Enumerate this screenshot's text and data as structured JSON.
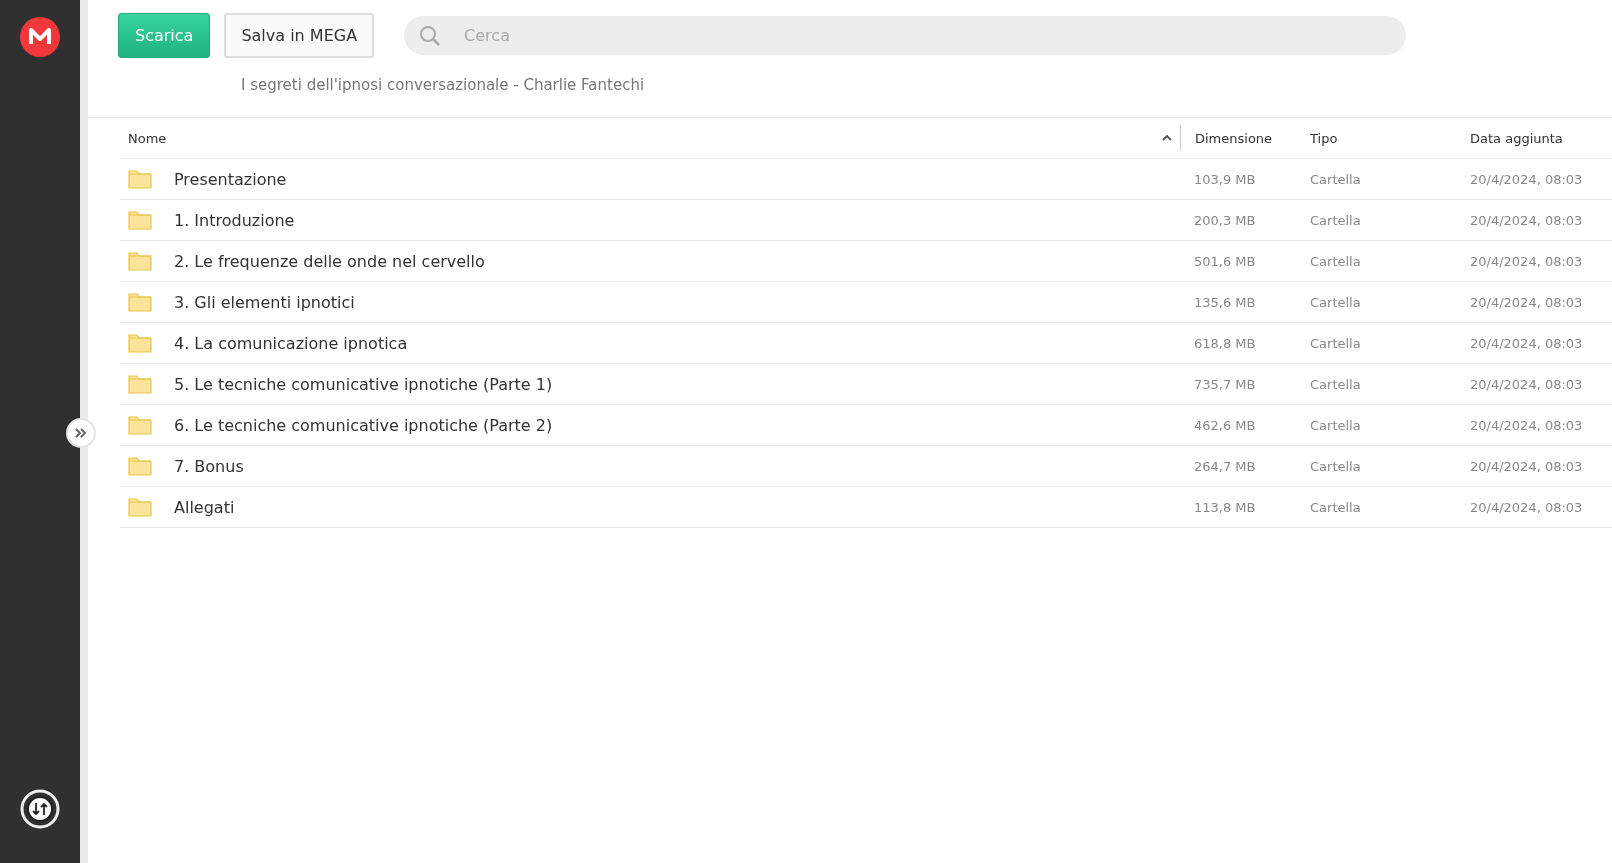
{
  "toolbar": {
    "download_button": "Scarica",
    "save_button": "Salva in MEGA",
    "search": {
      "placeholder": "Cerca"
    }
  },
  "folder_title": "I segreti dell'ipnosi conversazionale - Charlie Fantechi",
  "table": {
    "columns": [
      "Nome",
      "Dimensione",
      "Tipo",
      "Data aggiunta"
    ],
    "rows": [
      {
        "name": "Presentazione",
        "size": "103,9 MB",
        "type": "Cartella",
        "date": "20/4/2024, 08:03"
      },
      {
        "name": "1. Introduzione",
        "size": "200,3 MB",
        "type": "Cartella",
        "date": "20/4/2024, 08:03"
      },
      {
        "name": "2. Le frequenze delle onde nel cervello",
        "size": "501,6 MB",
        "type": "Cartella",
        "date": "20/4/2024, 08:03"
      },
      {
        "name": "3. Gli elementi ipnotici",
        "size": "135,6 MB",
        "type": "Cartella",
        "date": "20/4/2024, 08:03"
      },
      {
        "name": "4. La comunicazione ipnotica",
        "size": "618,8 MB",
        "type": "Cartella",
        "date": "20/4/2024, 08:03"
      },
      {
        "name": "5. Le tecniche comunicative ipnotiche (Parte 1)",
        "size": "735,7 MB",
        "type": "Cartella",
        "date": "20/4/2024, 08:03"
      },
      {
        "name": "6. Le tecniche comunicative ipnotiche (Parte 2)",
        "size": "462,6 MB",
        "type": "Cartella",
        "date": "20/4/2024, 08:03"
      },
      {
        "name": "7. Bonus",
        "size": "264,7 MB",
        "type": "Cartella",
        "date": "20/4/2024, 08:03"
      },
      {
        "name": "Allegati",
        "size": "113,8 MB",
        "type": "Cartella",
        "date": "20/4/2024, 08:03"
      }
    ]
  }
}
